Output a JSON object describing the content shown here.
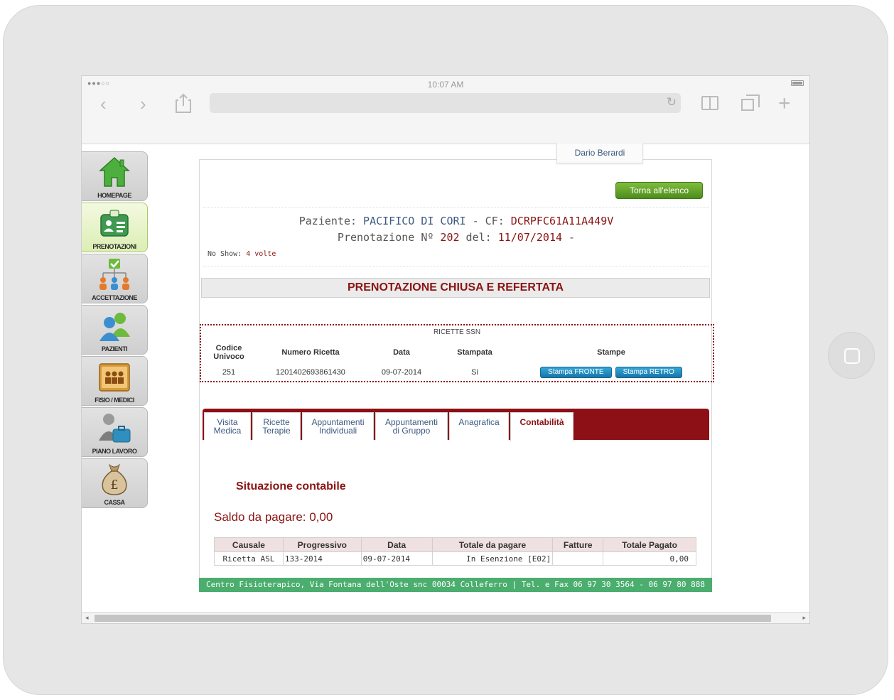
{
  "device": {
    "time": "10:07 AM",
    "signal": "●●●○○"
  },
  "browser": {
    "back_glyph": "‹",
    "forward_glyph": "›",
    "share_glyph": "⇪",
    "reload_glyph": "↻",
    "plus_glyph": "+"
  },
  "sidebar": {
    "items": [
      {
        "label": "HOMEPAGE",
        "icon": "house-icon"
      },
      {
        "label": "PRENOTAZIONI",
        "icon": "badge-icon"
      },
      {
        "label": "ACCETTAZIONE",
        "icon": "org-chart-icon"
      },
      {
        "label": "PAZIENTI",
        "icon": "people-icon"
      },
      {
        "label": "FISIO / MEDICI",
        "icon": "staff-folder-icon"
      },
      {
        "label": "PIANO LAVORO",
        "icon": "worker-briefcase-icon"
      },
      {
        "label": "CASSA",
        "icon": "money-bag-icon"
      }
    ]
  },
  "user": {
    "name": "Dario Berardi"
  },
  "header": {
    "back_button": "Torna all'elenco",
    "paziente_label": "Paziente:",
    "paziente_name": "PACIFICO DI CORI",
    "cf_label": "- CF:",
    "cf_value": "DCRPFC61A11A449V",
    "prenotazione_label": "Prenotazione Nº",
    "prenotazione_num": "202",
    "del_label": "del:",
    "prenotazione_date": "11/07/2014",
    "trailing_dash": "-",
    "noshow_label": "No Show:",
    "noshow_value": "4 volte"
  },
  "status": {
    "text": "PRENOTAZIONE CHIUSA E REFERTATA"
  },
  "ricette": {
    "title": "RICETTE SSN",
    "headers": {
      "codice": "Codice Univoco",
      "numero": "Numero Ricetta",
      "data": "Data",
      "stampata": "Stampata",
      "stampe": "Stampe"
    },
    "rows": [
      {
        "codice": "251",
        "numero": "1201402693861430",
        "data": "09-07-2014",
        "stampata": "Si",
        "btn_fronte": "Stampa FRONTE",
        "btn_retro": "Stampa RETRO"
      }
    ]
  },
  "tabs": [
    {
      "line1": "Visita",
      "line2": "Medica"
    },
    {
      "line1": "Ricette",
      "line2": "Terapie"
    },
    {
      "line1": "Appuntamenti",
      "line2": "Individuali"
    },
    {
      "line1": "Appuntamenti",
      "line2": "di Gruppo"
    },
    {
      "line1": "Anagrafica",
      "line2": ""
    },
    {
      "line1": "Contabilità",
      "line2": "",
      "active": true
    }
  ],
  "contabilita": {
    "title": "Situazione contabile",
    "saldo": "Saldo da pagare: 0,00",
    "headers": {
      "causale": "Causale",
      "progressivo": "Progressivo",
      "data": "Data",
      "totale": "Totale da pagare",
      "fatture": "Fatture",
      "pagato": "Totale Pagato"
    },
    "rows": [
      {
        "causale": "Ricetta ASL",
        "progressivo": "133-2014",
        "data": "09-07-2014",
        "totale": "In Esenzione [E02]",
        "fatture": "",
        "pagato": "0,00"
      }
    ]
  },
  "footer": {
    "text": "Centro Fisioterapico, Via Fontana dell'Oste snc 00034 Colleferro | Tel. e Fax 06 97 30 3564 - 06 97 80 888"
  },
  "colors": {
    "brand_red": "#8b1414",
    "tab_bar": "#8c1016",
    "footer_green": "#4bad6e",
    "button_green": "#5a9a24",
    "button_blue": "#1d86bb"
  }
}
